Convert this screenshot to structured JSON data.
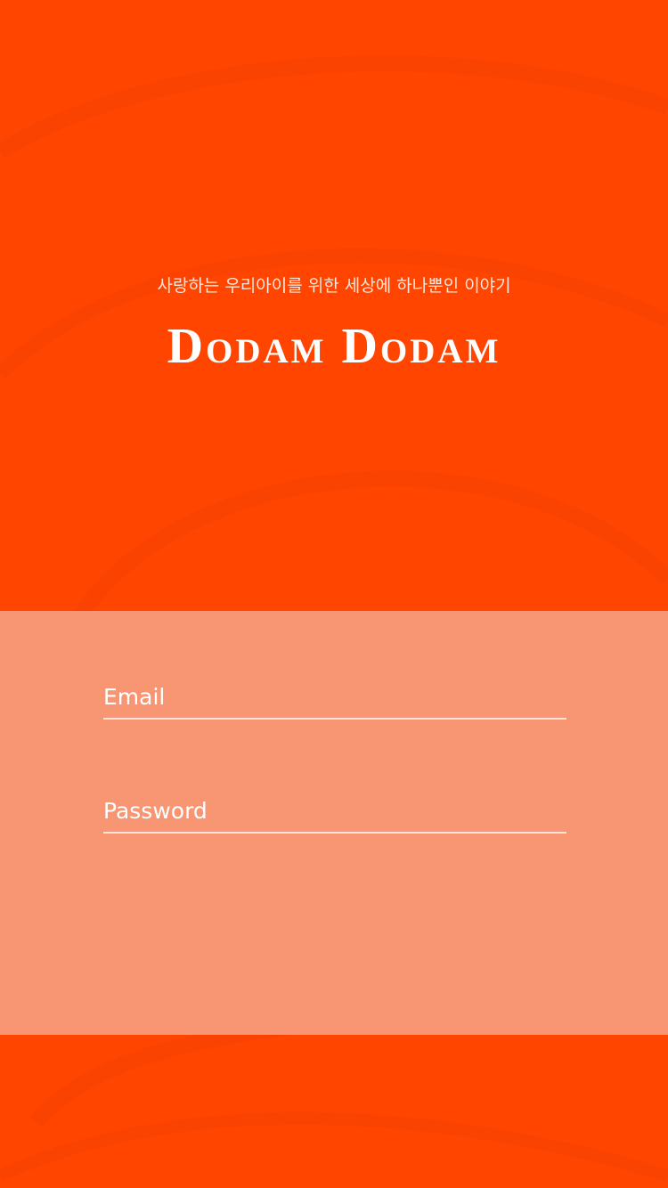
{
  "app": {
    "tagline": "사랑하는 우리아이를 위한 세상에 하나뿐인 이야기",
    "logo": "Dodam Dodam"
  },
  "login": {
    "email": {
      "placeholder": "Email",
      "value": ""
    },
    "password": {
      "placeholder": "Password",
      "value": ""
    }
  },
  "colors": {
    "background": "#ff4500",
    "panel": "#f89572",
    "text": "#ffffff",
    "underline": "#fde2d6"
  }
}
